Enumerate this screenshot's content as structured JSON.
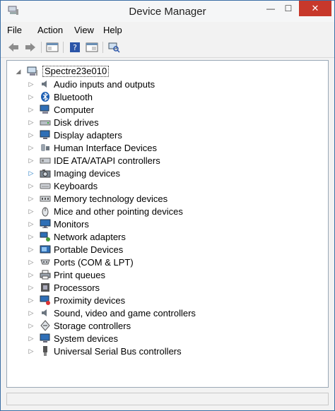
{
  "window": {
    "title": "Device Manager",
    "minimize_glyph": "—",
    "maximize_glyph": "☐",
    "close_glyph": "✕"
  },
  "menu": {
    "file": "File",
    "action": "Action",
    "view": "View",
    "help": "Help"
  },
  "toolbar": {
    "icons": [
      "back-arrow-icon",
      "forward-arrow-icon",
      "properties-icon",
      "help-icon",
      "show-hide-icon",
      "scan-hardware-icon"
    ]
  },
  "tree": {
    "root": "Spectre23e010",
    "categories": [
      "Audio inputs and outputs",
      "Bluetooth",
      "Computer",
      "Disk drives",
      "Display adapters",
      "Human Interface Devices",
      "IDE ATA/ATAPI controllers",
      "Imaging devices",
      "Keyboards",
      "Memory technology devices",
      "Mice and other pointing devices",
      "Monitors",
      "Network adapters",
      "Portable Devices",
      "Ports (COM & LPT)",
      "Print queues",
      "Processors",
      "Proximity devices",
      "Sound, video and game controllers",
      "Storage controllers",
      "System devices",
      "Universal Serial Bus controllers"
    ]
  }
}
